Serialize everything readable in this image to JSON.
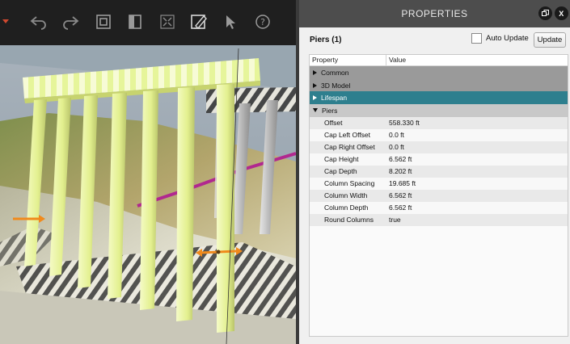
{
  "panel": {
    "title": "PROPERTIES",
    "selection_label": "Piers (1)",
    "auto_update_label": "Auto Update",
    "auto_update_checked": false,
    "update_button": "Update",
    "header_buttons": [
      "restore-icon",
      "close-icon"
    ],
    "close_glyph": "X"
  },
  "grid": {
    "col_property": "Property",
    "col_value": "Value",
    "categories": [
      {
        "label": "Common",
        "expanded": false,
        "selected": false
      },
      {
        "label": "3D Model",
        "expanded": false,
        "selected": false
      },
      {
        "label": "Lifespan",
        "expanded": false,
        "selected": true
      },
      {
        "label": "Piers",
        "expanded": true,
        "selected": false
      }
    ],
    "rows": [
      {
        "name": "Offset",
        "value": "558.330 ft"
      },
      {
        "name": "Cap Left Offset",
        "value": "0.0 ft"
      },
      {
        "name": "Cap Right Offset",
        "value": "0.0 ft"
      },
      {
        "name": "Cap Height",
        "value": "6.562 ft"
      },
      {
        "name": "Cap Depth",
        "value": "8.202 ft"
      },
      {
        "name": "Column Spacing",
        "value": "19.685 ft"
      },
      {
        "name": "Column Width",
        "value": "6.562 ft"
      },
      {
        "name": "Column Depth",
        "value": "6.562 ft"
      },
      {
        "name": "Round Columns",
        "value": "true"
      }
    ]
  },
  "toolbar": {
    "buttons": [
      "undo-icon",
      "redo-icon",
      "copy-window-icon",
      "panel-icon",
      "fit-view-icon",
      "edit-icon",
      "select-cursor-icon",
      "help-icon"
    ],
    "help_glyph": "?"
  },
  "colors": {
    "accent_selected": "#2e7f8e",
    "pier_color": "#e6f59a",
    "title_bar": "#4d4d4d"
  }
}
